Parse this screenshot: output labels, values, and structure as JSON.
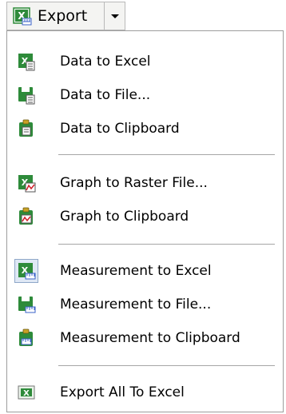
{
  "toolbar": {
    "export_label": "Export",
    "export_icon": "excel-icon",
    "dropdown_icon": "dropdown-arrow-icon"
  },
  "menu": {
    "items": [
      {
        "label": "Data to Excel",
        "icon": "excel-data-icon"
      },
      {
        "label": "Data to File...",
        "icon": "save-data-icon"
      },
      {
        "label": "Data to Clipboard",
        "icon": "clipboard-data-icon"
      },
      {
        "label": "Graph to Raster File...",
        "icon": "graph-file-icon"
      },
      {
        "label": "Graph to Clipboard",
        "icon": "clipboard-graph-icon"
      },
      {
        "label": "Measurement to Excel",
        "icon": "excel-measurement-icon"
      },
      {
        "label": "Measurement to File...",
        "icon": "save-measurement-icon"
      },
      {
        "label": "Measurement to Clipboard",
        "icon": "clipboard-measurement-icon"
      },
      {
        "label": "Export All To Excel",
        "icon": "excel-export-all-icon"
      }
    ]
  },
  "colors": {
    "excel_green": "#2e8b3a",
    "graph_red": "#d0202a",
    "ruler_blue": "#3a62c8",
    "highlight_border": "#8fa8c8",
    "highlight_bg": "#dfe8f5"
  }
}
